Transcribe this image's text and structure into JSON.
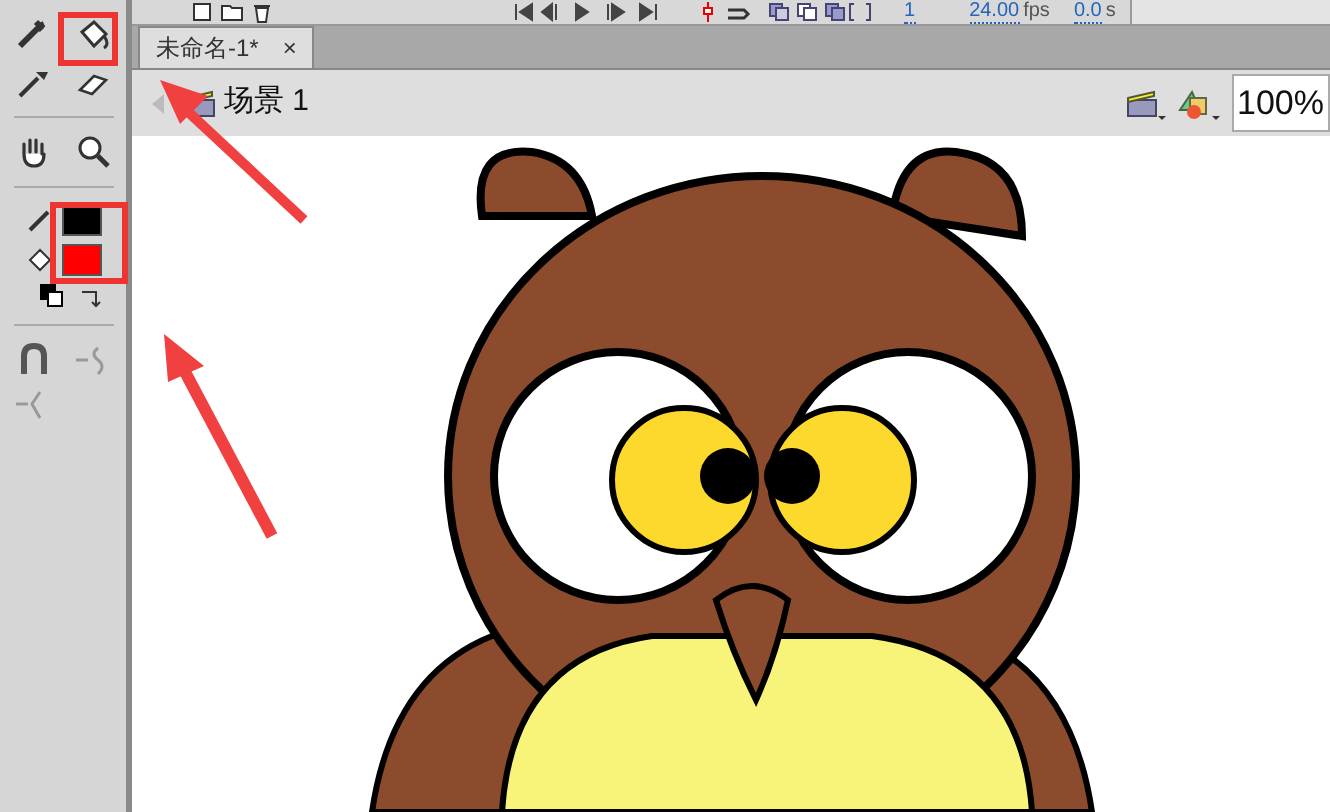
{
  "timeline": {
    "frame": "1",
    "fps_value": "24.00",
    "fps_unit": "fps",
    "time_value": "0.0",
    "time_unit": "s"
  },
  "document_tabs": [
    {
      "label": "未命名-1*",
      "close": "×",
      "selected": true
    }
  ],
  "edit_bar": {
    "scene": "场景 1",
    "zoom": "100%"
  },
  "swatches": [
    {
      "kind": "stroke",
      "color": "#000000"
    },
    {
      "kind": "fill",
      "color": "#ff0000"
    }
  ]
}
